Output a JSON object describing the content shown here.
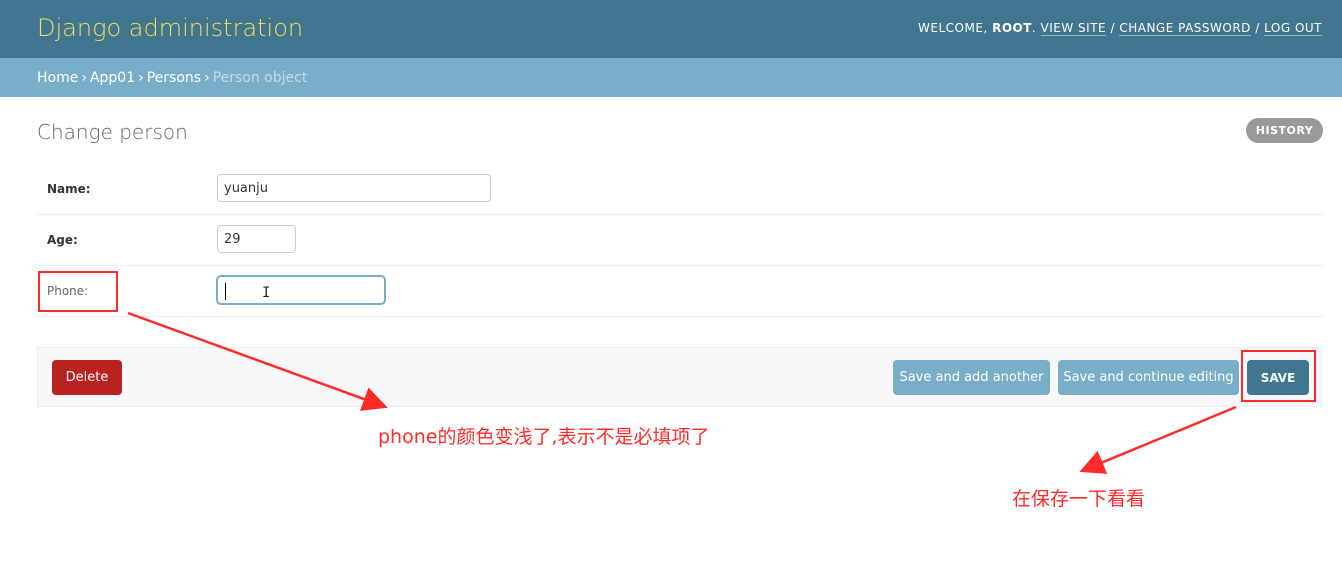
{
  "header": {
    "brand": "Django administration",
    "welcome": "WELCOME, ",
    "username": "ROOT",
    "view_site": "VIEW SITE",
    "change_password": "CHANGE PASSWORD",
    "log_out": "LOG OUT",
    "sep": "/"
  },
  "breadcrumbs": {
    "home": "Home",
    "app": "App01",
    "model": "Persons",
    "current": "Person object",
    "sep": "›"
  },
  "page": {
    "title": "Change person",
    "history": "HISTORY"
  },
  "form": {
    "fields": [
      {
        "label": "Name:",
        "value": "yuanju",
        "required": true
      },
      {
        "label": "Age:",
        "value": "29",
        "required": true
      },
      {
        "label": "Phone:",
        "value": "",
        "required": false
      }
    ]
  },
  "actions": {
    "delete": "Delete",
    "save_add": "Save and add another",
    "save_continue": "Save and continue editing",
    "save": "SAVE"
  },
  "annotations": {
    "phone_note": "phone的颜色变浅了,表示不是必填项了",
    "save_note": "在保存一下看看",
    "color": "#ff2a2a"
  },
  "colors": {
    "header_bg": "#417690",
    "brand_text": "#f5dd5d",
    "breadcrumb_bg": "#79aec8",
    "delete_bg": "#ba2121",
    "secondary_button_bg": "#79aec8",
    "primary_button_bg": "#417690"
  }
}
